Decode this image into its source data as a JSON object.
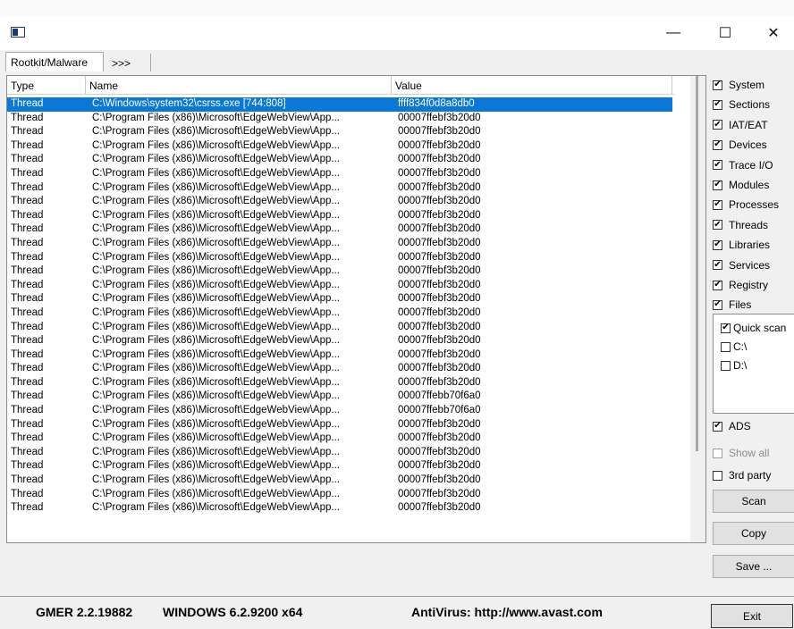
{
  "tabs": [
    "Rootkit/Malware",
    ">>>"
  ],
  "columns": [
    "Type",
    "Name",
    "Value"
  ],
  "rows": [
    {
      "type": "Thread",
      "name": "C:\\Windows\\system32\\csrss.exe [744:808]",
      "value": "ffff834f0d8a8db0",
      "selected": true
    },
    {
      "type": "Thread",
      "name": "C:\\Program Files (x86)\\Microsoft\\EdgeWebView\\App...",
      "value": "00007ffebf3b20d0"
    },
    {
      "type": "Thread",
      "name": "C:\\Program Files (x86)\\Microsoft\\EdgeWebView\\App...",
      "value": "00007ffebf3b20d0"
    },
    {
      "type": "Thread",
      "name": "C:\\Program Files (x86)\\Microsoft\\EdgeWebView\\App...",
      "value": "00007ffebf3b20d0"
    },
    {
      "type": "Thread",
      "name": "C:\\Program Files (x86)\\Microsoft\\EdgeWebView\\App...",
      "value": "00007ffebf3b20d0"
    },
    {
      "type": "Thread",
      "name": "C:\\Program Files (x86)\\Microsoft\\EdgeWebView\\App...",
      "value": "00007ffebf3b20d0"
    },
    {
      "type": "Thread",
      "name": "C:\\Program Files (x86)\\Microsoft\\EdgeWebView\\App...",
      "value": "00007ffebf3b20d0"
    },
    {
      "type": "Thread",
      "name": "C:\\Program Files (x86)\\Microsoft\\EdgeWebView\\App...",
      "value": "00007ffebf3b20d0"
    },
    {
      "type": "Thread",
      "name": "C:\\Program Files (x86)\\Microsoft\\EdgeWebView\\App...",
      "value": "00007ffebf3b20d0"
    },
    {
      "type": "Thread",
      "name": "C:\\Program Files (x86)\\Microsoft\\EdgeWebView\\App...",
      "value": "00007ffebf3b20d0"
    },
    {
      "type": "Thread",
      "name": "C:\\Program Files (x86)\\Microsoft\\EdgeWebView\\App...",
      "value": "00007ffebf3b20d0"
    },
    {
      "type": "Thread",
      "name": "C:\\Program Files (x86)\\Microsoft\\EdgeWebView\\App...",
      "value": "00007ffebf3b20d0"
    },
    {
      "type": "Thread",
      "name": "C:\\Program Files (x86)\\Microsoft\\EdgeWebView\\App...",
      "value": "00007ffebf3b20d0"
    },
    {
      "type": "Thread",
      "name": "C:\\Program Files (x86)\\Microsoft\\EdgeWebView\\App...",
      "value": "00007ffebf3b20d0"
    },
    {
      "type": "Thread",
      "name": "C:\\Program Files (x86)\\Microsoft\\EdgeWebView\\App...",
      "value": "00007ffebf3b20d0"
    },
    {
      "type": "Thread",
      "name": "C:\\Program Files (x86)\\Microsoft\\EdgeWebView\\App...",
      "value": "00007ffebf3b20d0"
    },
    {
      "type": "Thread",
      "name": "C:\\Program Files (x86)\\Microsoft\\EdgeWebView\\App...",
      "value": "00007ffebf3b20d0"
    },
    {
      "type": "Thread",
      "name": "C:\\Program Files (x86)\\Microsoft\\EdgeWebView\\App...",
      "value": "00007ffebf3b20d0"
    },
    {
      "type": "Thread",
      "name": "C:\\Program Files (x86)\\Microsoft\\EdgeWebView\\App...",
      "value": "00007ffebf3b20d0"
    },
    {
      "type": "Thread",
      "name": "C:\\Program Files (x86)\\Microsoft\\EdgeWebView\\App...",
      "value": "00007ffebf3b20d0"
    },
    {
      "type": "Thread",
      "name": "C:\\Program Files (x86)\\Microsoft\\EdgeWebView\\App...",
      "value": "00007ffebf3b20d0"
    },
    {
      "type": "Thread",
      "name": "C:\\Program Files (x86)\\Microsoft\\EdgeWebView\\App...",
      "value": "00007ffebb70f6a0"
    },
    {
      "type": "Thread",
      "name": "C:\\Program Files (x86)\\Microsoft\\EdgeWebView\\App...",
      "value": "00007ffebb70f6a0"
    },
    {
      "type": "Thread",
      "name": "C:\\Program Files (x86)\\Microsoft\\EdgeWebView\\App...",
      "value": "00007ffebf3b20d0"
    },
    {
      "type": "Thread",
      "name": "C:\\Program Files (x86)\\Microsoft\\EdgeWebView\\App...",
      "value": "00007ffebf3b20d0"
    },
    {
      "type": "Thread",
      "name": "C:\\Program Files (x86)\\Microsoft\\EdgeWebView\\App...",
      "value": "00007ffebf3b20d0"
    },
    {
      "type": "Thread",
      "name": "C:\\Program Files (x86)\\Microsoft\\EdgeWebView\\App...",
      "value": "00007ffebf3b20d0"
    },
    {
      "type": "Thread",
      "name": "C:\\Program Files (x86)\\Microsoft\\EdgeWebView\\App...",
      "value": "00007ffebf3b20d0"
    },
    {
      "type": "Thread",
      "name": "C:\\Program Files (x86)\\Microsoft\\EdgeWebView\\App...",
      "value": "00007ffebf3b20d0"
    },
    {
      "type": "Thread",
      "name": "C:\\Program Files (x86)\\Microsoft\\EdgeWebView\\App...",
      "value": "00007ffebf3b20d0"
    }
  ],
  "options": [
    {
      "label": "System",
      "checked": true
    },
    {
      "label": "Sections",
      "checked": true
    },
    {
      "label": "IAT/EAT",
      "checked": true
    },
    {
      "label": "Devices",
      "checked": true
    },
    {
      "label": "Trace I/O",
      "checked": true
    },
    {
      "label": "Modules",
      "checked": true
    },
    {
      "label": "Processes",
      "checked": true
    },
    {
      "label": "Threads",
      "checked": true
    },
    {
      "label": "Libraries",
      "checked": true
    },
    {
      "label": "Services",
      "checked": true
    },
    {
      "label": "Registry",
      "checked": true
    },
    {
      "label": "Files",
      "checked": true
    }
  ],
  "drives": [
    {
      "label": "Quick scan",
      "checked": true
    },
    {
      "label": "C:\\",
      "checked": false
    },
    {
      "label": "D:\\",
      "checked": false
    }
  ],
  "ads": {
    "label": "ADS",
    "checked": true
  },
  "show_all": {
    "label": "Show all",
    "checked": false
  },
  "third_party": {
    "label": "3rd party",
    "checked": false
  },
  "buttons": {
    "scan": "Scan",
    "copy": "Copy",
    "save": "Save ...",
    "exit": "Exit"
  },
  "status": {
    "version": "GMER 2.2.19882",
    "os": "WINDOWS 6.2.9200  x64",
    "antivirus": "AntiVirus: http://www.avast.com"
  },
  "caption": {
    "minimize": "—",
    "maximize": "☐",
    "close": "✕"
  }
}
